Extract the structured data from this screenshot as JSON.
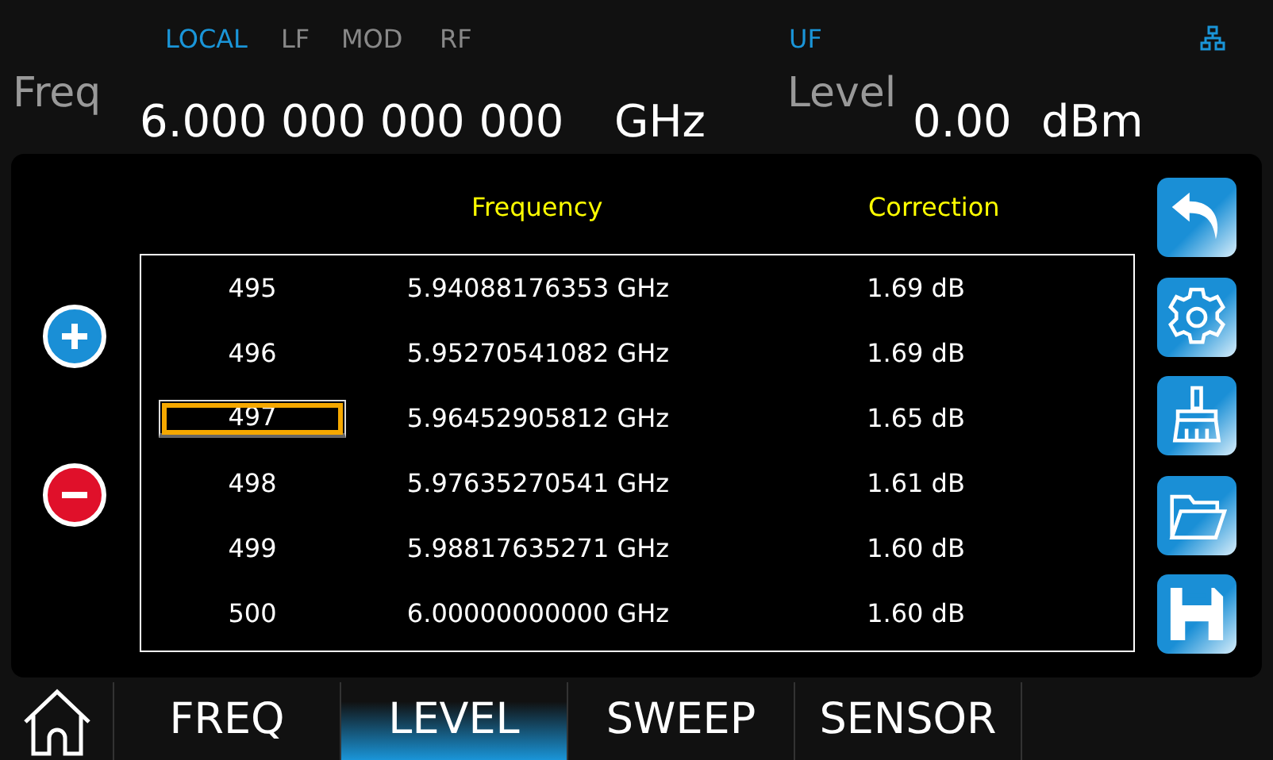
{
  "status": {
    "indicators": [
      {
        "label": "LOCAL",
        "active": true
      },
      {
        "label": "LF",
        "active": false
      },
      {
        "label": "MOD",
        "active": false
      },
      {
        "label": "RF",
        "active": false
      }
    ],
    "right_indicators": [
      {
        "label": "UF",
        "active": true
      }
    ]
  },
  "freq": {
    "label": "Freq",
    "value": "6.000 000 000 000",
    "unit": "GHz"
  },
  "level": {
    "label": "Level",
    "value": "0.00",
    "unit": "dBm"
  },
  "table": {
    "columns": [
      "Frequency",
      "Correction"
    ],
    "rows": [
      {
        "index": "495",
        "frequency": "5.94088176353 GHz",
        "correction": "1.69 dB",
        "selected": false
      },
      {
        "index": "496",
        "frequency": "5.95270541082 GHz",
        "correction": "1.69 dB",
        "selected": false
      },
      {
        "index": "497",
        "frequency": "5.96452905812 GHz",
        "correction": "1.65 dB",
        "selected": true
      },
      {
        "index": "498",
        "frequency": "5.97635270541 GHz",
        "correction": "1.61 dB",
        "selected": false
      },
      {
        "index": "499",
        "frequency": "5.98817635271 GHz",
        "correction": "1.60 dB",
        "selected": false
      },
      {
        "index": "500",
        "frequency": "6.00000000000 GHz",
        "correction": "1.60 dB",
        "selected": false
      }
    ]
  },
  "side_buttons": [
    {
      "kind": "back"
    },
    {
      "kind": "settings"
    },
    {
      "kind": "clear"
    },
    {
      "kind": "open"
    },
    {
      "kind": "save"
    }
  ],
  "tabs": [
    {
      "label": "FREQ",
      "selected": false
    },
    {
      "label": "LEVEL",
      "selected": true
    },
    {
      "label": "SWEEP",
      "selected": false
    },
    {
      "label": "SENSOR",
      "selected": false
    }
  ]
}
